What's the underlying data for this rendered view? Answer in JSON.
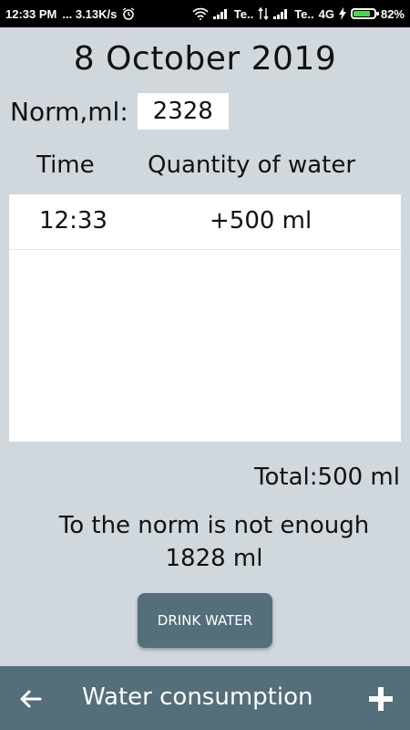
{
  "status_bar": {
    "time": "12:33 PM",
    "speed": "... 3.13K/s",
    "carrier1": "Te..",
    "carrier2": "Te..",
    "network": "4G",
    "battery_pct": "82%",
    "battery_level": 0.82,
    "battery_color": "#4cd64c"
  },
  "date": "8 October 2019",
  "norm": {
    "label": "Norm,ml:",
    "value": "2328"
  },
  "columns": {
    "time": "Time",
    "quantity": "Quantity of water"
  },
  "entries": [
    {
      "time": "12:33",
      "quantity": "+500 ml"
    }
  ],
  "total": "Total:500 ml",
  "message": {
    "line1": "To the norm is not enough",
    "line2": "1828  ml"
  },
  "drink_button": "DRINK WATER",
  "bottom_bar": {
    "title": "Water consumption",
    "back_icon": "arrow-left-icon",
    "add_icon": "plus-icon"
  },
  "colors": {
    "background": "#d0d8dd",
    "accent": "#546e7a"
  }
}
